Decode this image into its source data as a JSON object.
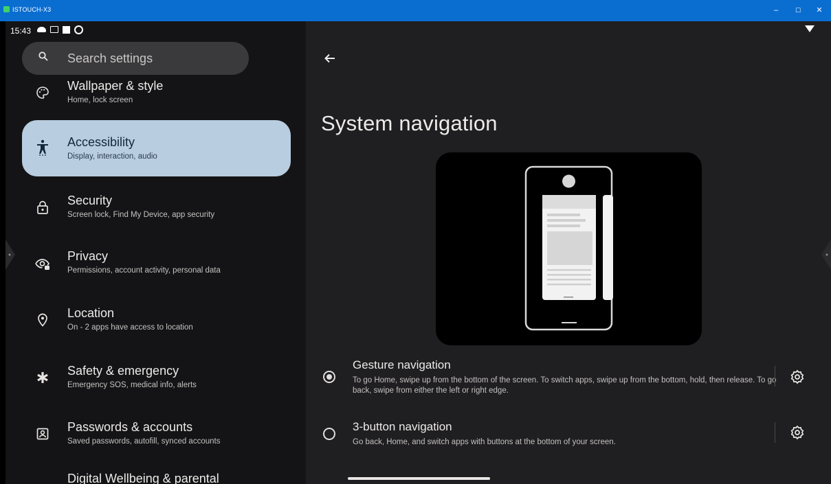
{
  "window": {
    "title": "ISTOUCH-X3",
    "controls": [
      "–",
      "☐",
      "✕"
    ],
    "title_bar_color": "#0a6ed1"
  },
  "status_bar": {
    "time": "15:43",
    "icons": [
      "cloud-icon",
      "screen-record-icon",
      "square-icon",
      "gear-icon"
    ],
    "right_icons": [
      "wifi-icon"
    ]
  },
  "search": {
    "placeholder": "Search settings",
    "icon": "search-icon"
  },
  "sidebar": {
    "items": [
      {
        "title": "Wallpaper & style",
        "subtitle": "Home, lock screen",
        "icon": "palette-icon",
        "selected": false
      },
      {
        "title": "Accessibility",
        "subtitle": "Display, interaction, audio",
        "icon": "accessibility-icon",
        "selected": true
      },
      {
        "title": "Security",
        "subtitle": "Screen lock, Find My Device, app security",
        "icon": "lock-icon",
        "selected": false
      },
      {
        "title": "Privacy",
        "subtitle": "Permissions, account activity, personal data",
        "icon": "privacy-eye-icon",
        "selected": false
      },
      {
        "title": "Location",
        "subtitle": "On - 2 apps have access to location",
        "icon": "location-pin-icon",
        "selected": false
      },
      {
        "title": "Safety & emergency",
        "subtitle": "Emergency SOS, medical info, alerts",
        "icon": "asterisk-icon",
        "selected": false
      },
      {
        "title": "Passwords & accounts",
        "subtitle": "Saved passwords, autofill, synced accounts",
        "icon": "account-box-icon",
        "selected": false
      },
      {
        "title": "Digital Wellbeing & parental",
        "subtitle": "",
        "icon": "",
        "selected": false
      }
    ],
    "selected_color": "#b9cde0"
  },
  "main": {
    "title": "System navigation",
    "back_icon": "back-arrow-icon",
    "options": [
      {
        "title": "Gesture navigation",
        "description": "To go Home, swipe up from the bottom of the screen. To switch apps, swipe up from the bottom, hold, then release. To go back, swipe from either the left or right edge.",
        "selected": true,
        "settings_icon": "settings-gear-icon"
      },
      {
        "title": "3-button navigation",
        "description": "Go back, Home, and switch apps with buttons at the bottom of your screen.",
        "selected": false,
        "settings_icon": "settings-gear-icon"
      }
    ]
  }
}
